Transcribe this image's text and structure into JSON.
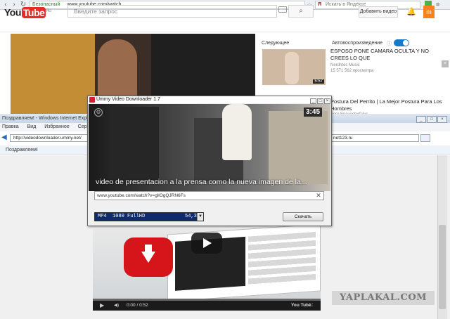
{
  "chrome": {
    "security_label": "Безопасный",
    "url": "www.youtube.com/watch",
    "yandex_search_placeholder": "Искать в Яндексе"
  },
  "youtube": {
    "logo_you": "You",
    "logo_tube": "Tube",
    "logo_region": "RU",
    "search_placeholder": "Введите запрос",
    "add_video_label": "Добавить видео",
    "avatar_letter": "m",
    "next_label": "Следующее",
    "autoplay_label": "Автовоспроизведение",
    "autoplay_on": true,
    "up_next": [
      {
        "title": "ESPOSO PONE CAMARA OCULTA Y NO CREES LO QUE",
        "channel": "Nerdhtos Music",
        "views": "15 571 562 просмотра",
        "duration": "5:57"
      },
      {
        "title": "Postura Del Perrito | La Mejor Postura Para Los Hombres",
        "channel": "Foro Encuesterfalvs"
      }
    ]
  },
  "ie": {
    "window_title": "Поздравляем! - Windows Internet Explorer",
    "menu": [
      "Правка",
      "Вид",
      "Избранное",
      "Сервис",
      "Сп"
    ],
    "address": "http://videodownloader.ummy.net/",
    "address_right": "net123.ru",
    "congrats_tab": "Поздравляем!"
  },
  "ummy": {
    "title": "Ummy Video Downloader 1.7",
    "preview_duration": "3:45",
    "video_title": "video de presentacion a la prensa como la nueva imagen de la...",
    "url": "www.youtube.com/watch?v=gllOgQJRN6Fs",
    "format": "MP4  1080 FullHD",
    "format_size": "54,3",
    "download_label": "Скачать"
  },
  "lower_video": {
    "time": "0:00 / 0:52",
    "yt_label": "You Tube"
  },
  "watermark": "YAPLAKAL.COM",
  "colors": {
    "youtube_red": "#e52d27",
    "autoplay_blue": "#167ac6",
    "format_bg": "#102a6e"
  }
}
